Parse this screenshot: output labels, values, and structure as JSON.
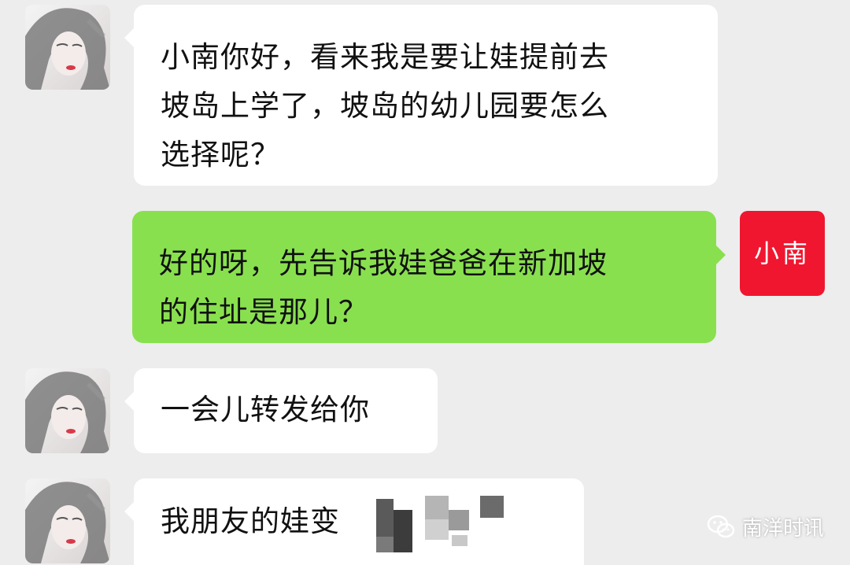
{
  "colors": {
    "background": "#ededed",
    "incoming_bubble": "#ffffff",
    "outgoing_bubble": "#89e04f",
    "self_avatar": "#f0162f"
  },
  "messages": [
    {
      "direction": "incoming",
      "text": "小南你好，看来我是要让娃提前去\n坡岛上学了，坡岛的幼儿园要怎么\n选择呢？"
    },
    {
      "direction": "outgoing",
      "text": "好的呀，先告诉我娃爸爸在新加坡\n的住址是那儿？"
    },
    {
      "direction": "incoming",
      "text": "一会儿转发给你"
    },
    {
      "direction": "incoming",
      "text": "我朋友的娃变"
    }
  ],
  "self_avatar": {
    "label": "小南"
  },
  "watermark": {
    "icon": "wechat-icon",
    "label": "南洋时讯"
  }
}
